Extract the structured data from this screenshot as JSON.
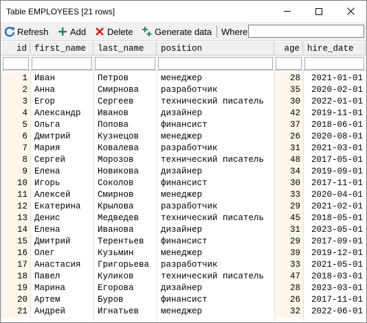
{
  "window": {
    "title": "Table EMPLOYEES [21 rows]"
  },
  "toolbar": {
    "refresh_label": "Refresh",
    "add_label": "Add",
    "delete_label": "Delete",
    "generate_label": "Generate data",
    "where_label": "Where",
    "where_value": ""
  },
  "icons": {
    "refresh": "refresh-icon",
    "add": "plus-icon",
    "delete": "x-icon",
    "generate": "generate-icon"
  },
  "colors": {
    "refresh_icon": "#1f5fbf",
    "add_icon": "#1f8a4c",
    "delete_icon": "#d11a1a",
    "generate_icon": "#1f8a4c",
    "numeric_column_bg": "#fdf6e9"
  },
  "table": {
    "columns": [
      "id",
      "first_name",
      "last_name",
      "position",
      "age",
      "hire_date"
    ],
    "rows": [
      [
        "1",
        "Иван",
        "Петров",
        "менеджер",
        "28",
        "2021-01-01"
      ],
      [
        "2",
        "Анна",
        "Смирнова",
        "разработчик",
        "35",
        "2020-02-01"
      ],
      [
        "3",
        "Егор",
        "Сергеев",
        "технический писатель",
        "30",
        "2022-01-01"
      ],
      [
        "4",
        "Александр",
        "Иванов",
        "дизайнер",
        "42",
        "2019-11-01"
      ],
      [
        "5",
        "Ольга",
        "Попова",
        "финансист",
        "37",
        "2018-06-01"
      ],
      [
        "6",
        "Дмитрий",
        "Кузнецов",
        "менеджер",
        "26",
        "2020-08-01"
      ],
      [
        "7",
        "Мария",
        "Ковалева",
        "разработчик",
        "31",
        "2021-03-01"
      ],
      [
        "8",
        "Сергей",
        "Морозов",
        "технический писатель",
        "48",
        "2017-05-01"
      ],
      [
        "9",
        "Елена",
        "Новикова",
        "дизайнер",
        "34",
        "2019-09-01"
      ],
      [
        "10",
        "Игорь",
        "Соколов",
        "финансист",
        "30",
        "2017-11-01"
      ],
      [
        "11",
        "Алексей",
        "Смирнов",
        "менеджер",
        "33",
        "2020-04-01"
      ],
      [
        "12",
        "Екатерина",
        "Крылова",
        "разработчик",
        "29",
        "2021-02-01"
      ],
      [
        "13",
        "Денис",
        "Медведев",
        "технический писатель",
        "45",
        "2018-05-01"
      ],
      [
        "14",
        "Елена",
        "Иванова",
        "дизайнер",
        "31",
        "2023-05-01"
      ],
      [
        "15",
        "Дмитрий",
        "Терентьев",
        "финансист",
        "29",
        "2017-09-01"
      ],
      [
        "16",
        "Олег",
        "Кузьмин",
        "менеджер",
        "39",
        "2019-12-01"
      ],
      [
        "17",
        "Анастасия",
        "Григорьева",
        "разработчик",
        "33",
        "2021-05-01"
      ],
      [
        "18",
        "Павел",
        "Куликов",
        "технический писатель",
        "47",
        "2018-03-01"
      ],
      [
        "19",
        "Марина",
        "Егорова",
        "дизайнер",
        "28",
        "2023-03-01"
      ],
      [
        "20",
        "Артем",
        "Буров",
        "финансист",
        "26",
        "2017-11-01"
      ],
      [
        "21",
        "Андрей",
        "Игнатьев",
        "менеджер",
        "32",
        "2022-06-01"
      ]
    ]
  }
}
